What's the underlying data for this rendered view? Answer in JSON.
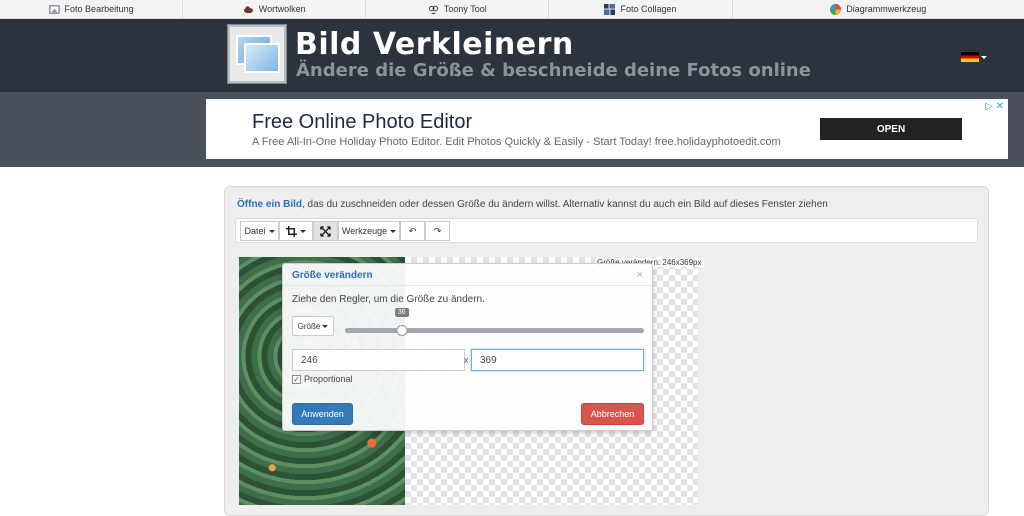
{
  "topnav": [
    {
      "label": "Foto Bearbeitung",
      "icon": "photo-edit-icon"
    },
    {
      "label": "Wortwolken",
      "icon": "cloud-icon"
    },
    {
      "label": "Toony Tool",
      "icon": "toony-face-icon"
    },
    {
      "label": "Foto Collagen",
      "icon": "collage-icon"
    },
    {
      "label": "Diagrammwerkzeug",
      "icon": "pie-chart-icon"
    }
  ],
  "header": {
    "title": "Bild Verkleinern",
    "subtitle": "Ändere die Größe & beschneide deine Fotos online",
    "language_flag": "de-flag-icon"
  },
  "ad": {
    "title": "Free Online Photo Editor",
    "description": "A Free All-In-One Holiday Photo Editor. Edit Photos Quickly & Easily - Start Today! free.holidayphotoedit.com",
    "cta": "OPEN",
    "choice_icon": "▷ ✕"
  },
  "intro": {
    "link": "Öffne ein Bild",
    "rest": ", das du zuschneiden oder dessen Größe du ändern willst. Alternativ kannst du auch ein Bild auf dieses Fenster ziehen"
  },
  "toolbar": {
    "file": "Datei",
    "crop_icon": "crop-icon",
    "resize_icon": "resize-arrows-icon",
    "tools": "Werkzeuge",
    "undo": "↶",
    "redo": "↷"
  },
  "canvas": {
    "size_label": "Größe verändern: 246x369px"
  },
  "dialog": {
    "title": "Größe verändern",
    "close": "×",
    "hint": "Ziehe den Regler, um die Größe zu ändern.",
    "mode": "Größe",
    "slider_value": "36",
    "slider_fraction": 0.19,
    "width": "246",
    "height": "369",
    "times": "x",
    "proportional_label": "Proportional",
    "proportional_checked": true,
    "apply": "Anwenden",
    "cancel": "Abbrechen"
  },
  "colors": {
    "header_bg": "#2b333c",
    "ad_band": "#49525b",
    "accent": "#2a6fb8",
    "apply": "#337ab7",
    "cancel": "#d9534f"
  }
}
